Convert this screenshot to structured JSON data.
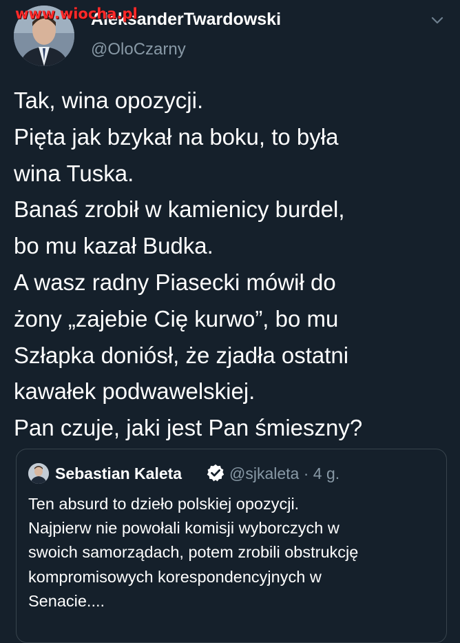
{
  "watermark": "www.wiocha.pl",
  "author": {
    "display_name": "AleksanderTwardowski",
    "handle": "@OloCzarny"
  },
  "tweet": {
    "lines": [
      "Tak, wina opozycji.",
      "Pięta jak bzykał na boku, to była",
      "wina Tuska.",
      "Banaś zrobił w kamienicy burdel,",
      "bo mu kazał Budka.",
      "A wasz radny Piasecki mówił do",
      "żony „zajebie Cię kurwo”, bo mu",
      "Szłapka doniósł, że zjadła ostatni",
      "kawałek podwawelskiej.",
      "Pan czuje, jaki jest Pan śmieszny?"
    ]
  },
  "quoted": {
    "display_name": "Sebastian Kaleta",
    "handle_time": "@sjkaleta · 4 g.",
    "lines": [
      "Ten absurd to dzieło polskiej opozycji.",
      "Najpierw nie powołali komisji wyborczych w",
      "swoich samorządach, potem zrobili obstrukcję",
      "kompromisowych korespondencyjnych w",
      "Senacie...."
    ]
  },
  "colors": {
    "background": "#15202b",
    "secondary_text": "#8899a6",
    "border": "#38444d",
    "watermark": "#ff2a2a"
  },
  "icons": {
    "menu": "chevron-down-icon",
    "verified": "verified-badge-icon"
  }
}
